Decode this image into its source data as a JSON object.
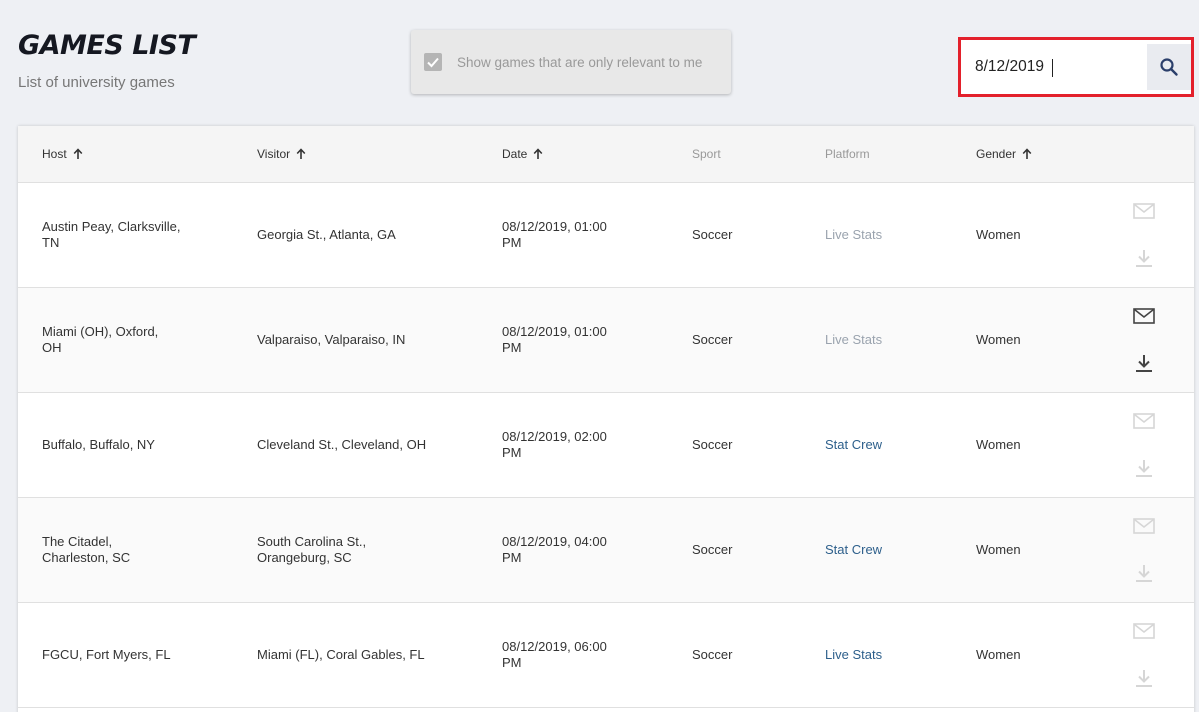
{
  "header": {
    "title": "GAMES LIST",
    "subtitle": "List of university games"
  },
  "filter": {
    "label": "Show games that are only relevant to me",
    "checked": true
  },
  "search": {
    "value": "8/12/2019",
    "icon": "search-icon"
  },
  "columns": [
    {
      "label": "Host",
      "sortable": true
    },
    {
      "label": "Visitor",
      "sortable": true
    },
    {
      "label": "Date",
      "sortable": true
    },
    {
      "label": "Sport",
      "sortable": false
    },
    {
      "label": "Platform",
      "sortable": false
    },
    {
      "label": "Gender",
      "sortable": true
    }
  ],
  "rows": [
    {
      "host": [
        "Austin Peay, Clarksville,",
        "TN"
      ],
      "visitor": [
        "Georgia St., Atlanta, GA"
      ],
      "date": [
        "08/12/2019, 01:00",
        "PM"
      ],
      "sport": "Soccer",
      "platform": "Live Stats",
      "platform_status": "muted",
      "gender": "Women",
      "actions_enabled": false
    },
    {
      "host": [
        "Miami (OH), Oxford,",
        "OH"
      ],
      "visitor": [
        "Valparaiso, Valparaiso, IN"
      ],
      "date": [
        "08/12/2019, 01:00",
        "PM"
      ],
      "sport": "Soccer",
      "platform": "Live Stats",
      "platform_status": "muted",
      "gender": "Women",
      "actions_enabled": true
    },
    {
      "host": [
        "Buffalo, Buffalo, NY"
      ],
      "visitor": [
        "Cleveland St., Cleveland, OH"
      ],
      "date": [
        "08/12/2019, 02:00",
        "PM"
      ],
      "sport": "Soccer",
      "platform": "Stat Crew",
      "platform_status": "active",
      "gender": "Women",
      "actions_enabled": false
    },
    {
      "host": [
        "The Citadel,",
        "Charleston, SC"
      ],
      "visitor": [
        "South Carolina St.,",
        "Orangeburg, SC"
      ],
      "date": [
        "08/12/2019, 04:00",
        "PM"
      ],
      "sport": "Soccer",
      "platform": "Stat Crew",
      "platform_status": "active",
      "gender": "Women",
      "actions_enabled": false
    },
    {
      "host": [
        "FGCU, Fort Myers, FL"
      ],
      "visitor": [
        "Miami (FL), Coral Gables, FL"
      ],
      "date": [
        "08/12/2019, 06:00",
        "PM"
      ],
      "sport": "Soccer",
      "platform": "Live Stats",
      "platform_status": "active",
      "gender": "Women",
      "actions_enabled": false
    }
  ],
  "colors": {
    "highlight_border": "#e3202b",
    "link_active": "#2d5f8b",
    "link_muted": "#9aa3ae",
    "icon_enabled": "#444444",
    "icon_disabled": "#d6d6d6"
  }
}
